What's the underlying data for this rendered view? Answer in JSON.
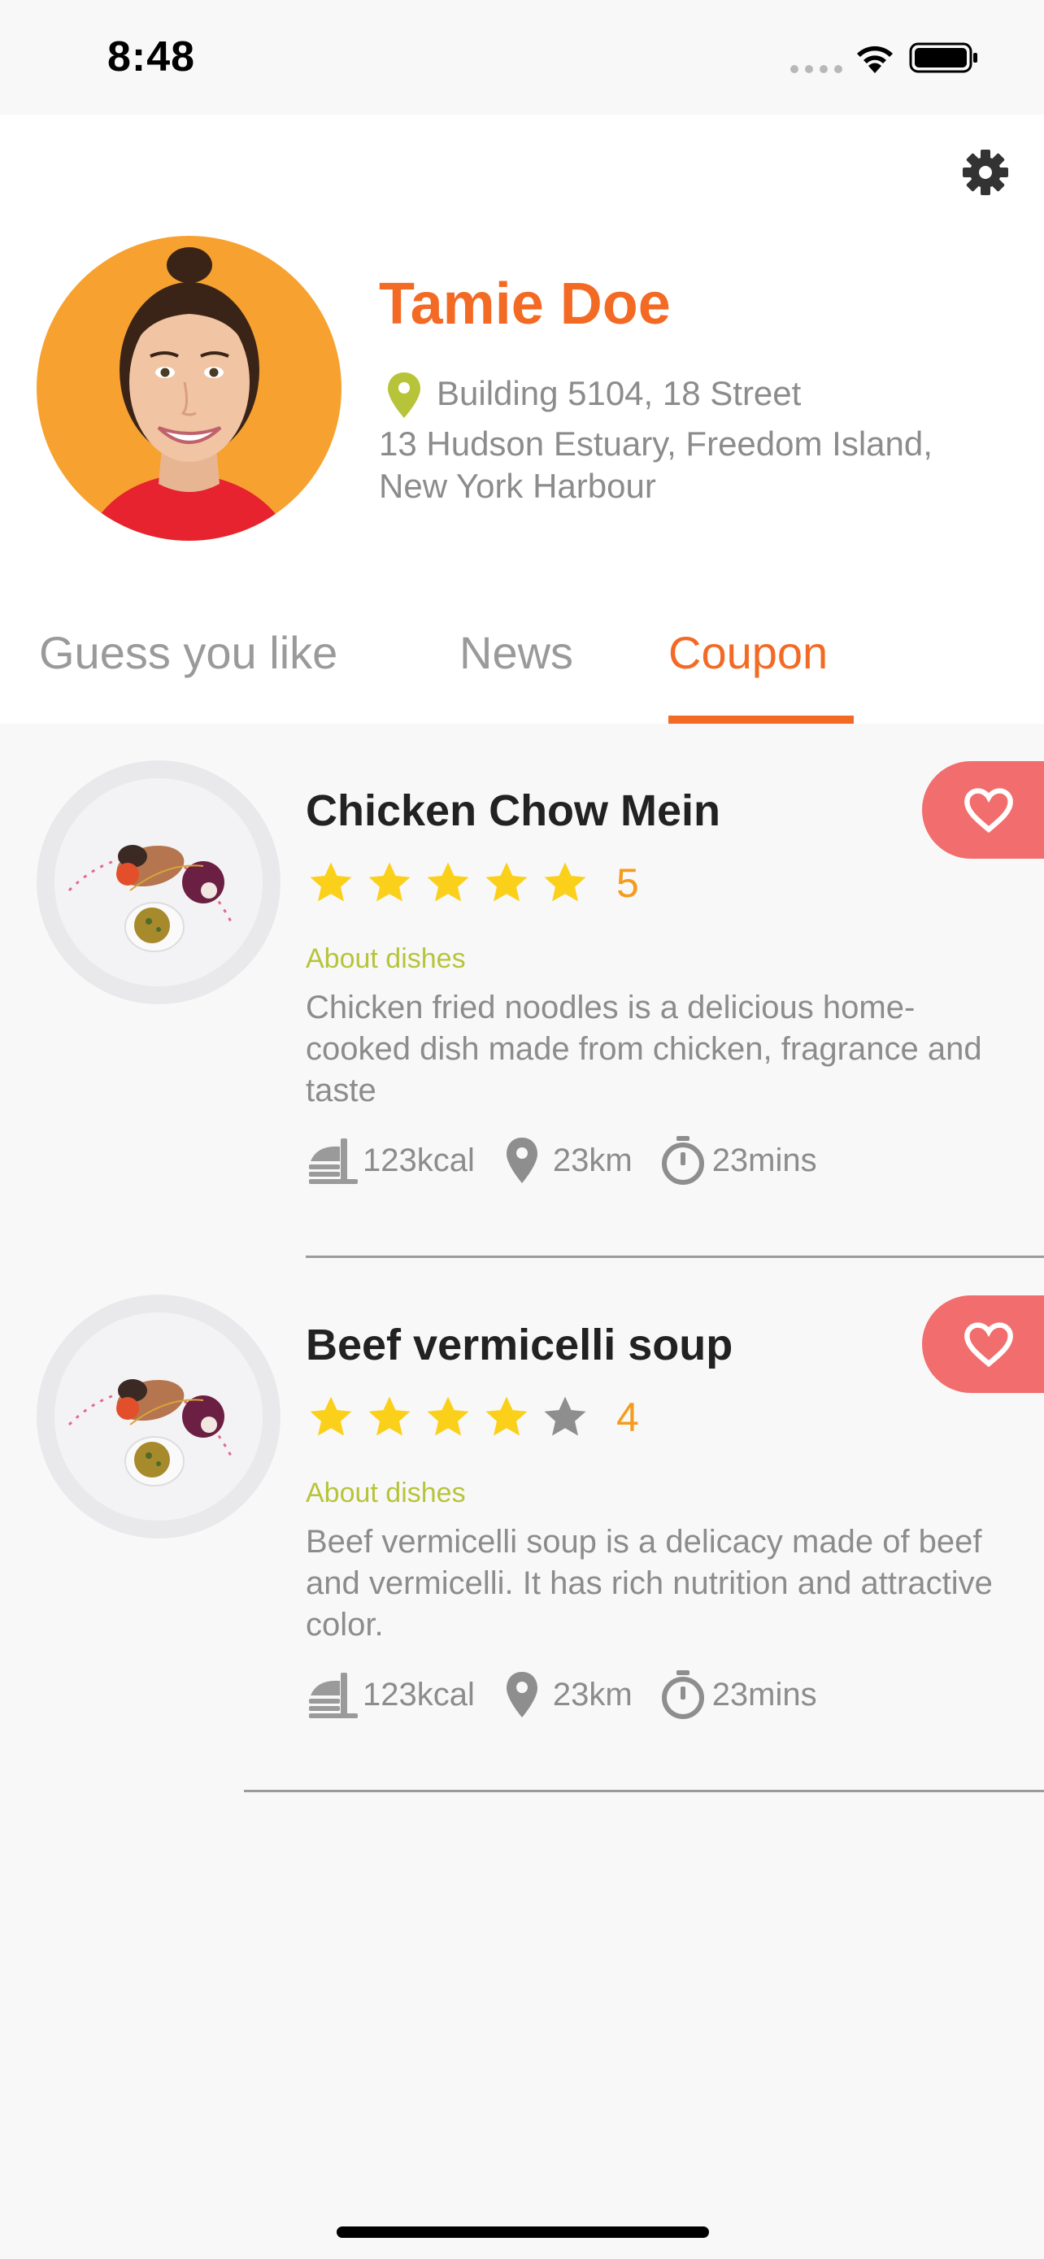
{
  "status_bar": {
    "time": "8:48"
  },
  "profile": {
    "name": "Tamie Doe",
    "address_line1": "Building 5104, 18 Street",
    "address_line2": "13 Hudson Estuary, Freedom Island, New York Harbour"
  },
  "tabs": [
    {
      "label": "Guess you like",
      "active": false
    },
    {
      "label": "News",
      "active": false
    },
    {
      "label": "Coupon",
      "active": true
    }
  ],
  "dishes": [
    {
      "title": "Chicken Chow Mein",
      "rating": 5,
      "rating_label": "5",
      "about_label": "About dishes",
      "description": "Chicken fried noodles is a delicious home-cooked dish made from chicken, fragrance and taste",
      "calories": "123kcal",
      "distance": "23km",
      "time": "23mins"
    },
    {
      "title": "Beef vermicelli soup",
      "rating": 4,
      "rating_label": "4",
      "about_label": "About dishes",
      "description": "Beef vermicelli soup is a delicacy made of beef and vermicelli. It has rich nutrition and attractive color.",
      "calories": "123kcal",
      "distance": "23km",
      "time": "23mins"
    }
  ],
  "colors": {
    "accent": "#f36a24",
    "star": "#fbd01a",
    "star_empty": "#8e8e8e",
    "rating_text": "#f39c1d",
    "about": "#b7c43a",
    "heart_bg": "#f26d6d",
    "pin_green": "#b7c43a"
  },
  "icons": [
    "settings-gear-icon",
    "location-pin-icon",
    "star-icon",
    "heart-icon",
    "food-tray-icon",
    "timer-icon"
  ]
}
